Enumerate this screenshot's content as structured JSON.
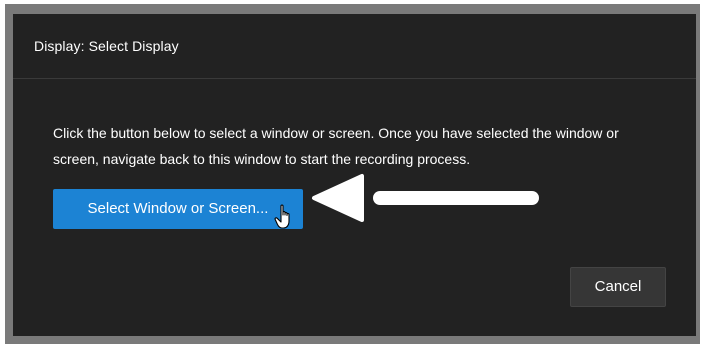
{
  "dialog": {
    "title": "Display: Select Display",
    "message": "Click the button below to select a window or screen. Once you have selected the window or screen, navigate back to this window to start the recording process.",
    "select_button_label": "Select Window or Screen...",
    "cancel_button_label": "Cancel"
  },
  "icons": {
    "arrow": "left-arrow-icon",
    "cursor": "hand-pointer-icon"
  },
  "colors": {
    "dialog_background": "#222222",
    "frame_border": "#7a7a7a",
    "primary_button": "#1c83d4",
    "secondary_button": "#363636",
    "text": "#ffffff"
  }
}
